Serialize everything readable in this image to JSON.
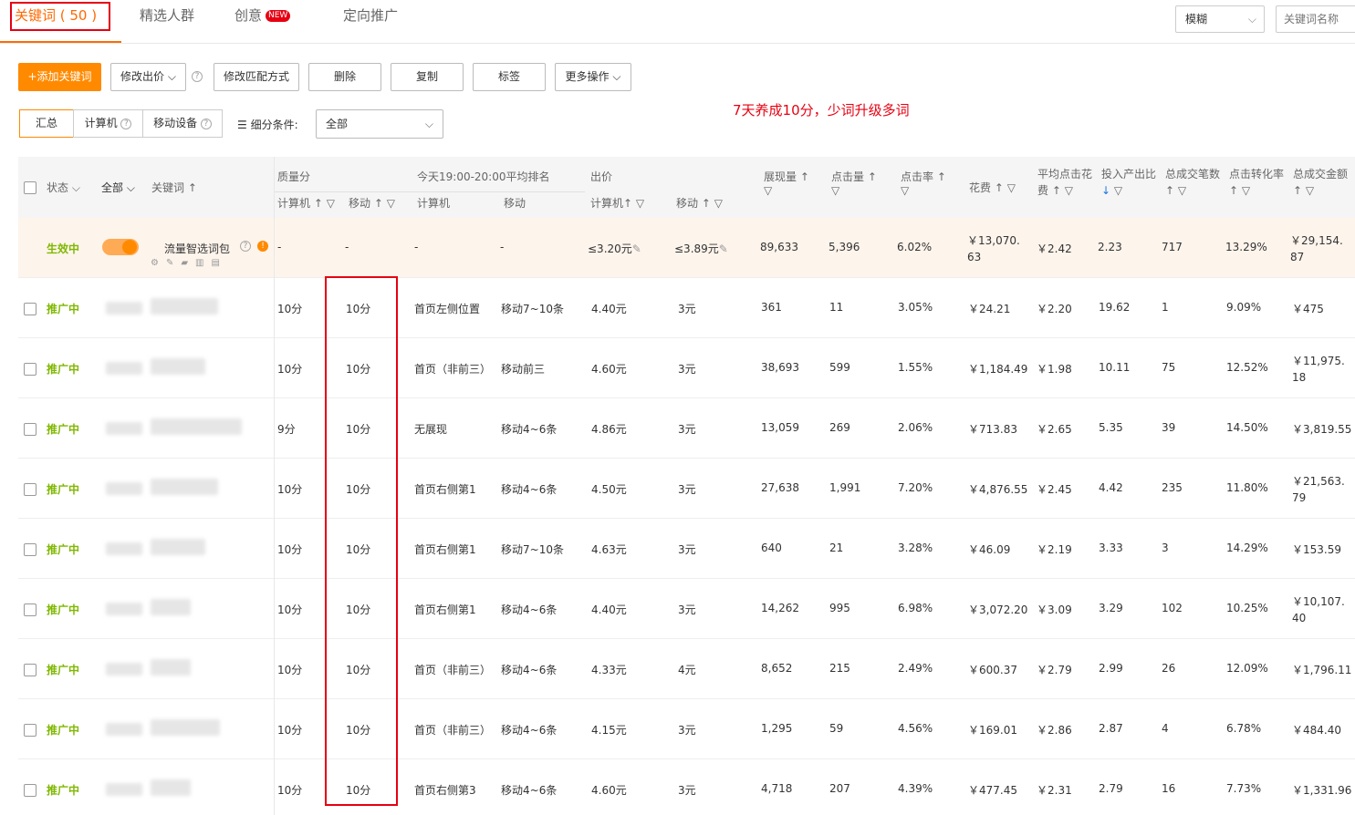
{
  "tabs": [
    {
      "label": "关键词 ( 50 )"
    },
    {
      "label": "精选人群"
    },
    {
      "label": "创意",
      "badge": "NEW"
    },
    {
      "label": "定向推广"
    }
  ],
  "match_mode": "模糊",
  "search_placeholder": "关键词名称",
  "toolbar": {
    "add_keyword": "+添加关键词",
    "edit_bid": "修改出价",
    "edit_match": "修改匹配方式",
    "delete": "删除",
    "copy": "复制",
    "tag": "标签",
    "more": "更多操作"
  },
  "promo": "7天养成10分，少词升级多词",
  "segments": [
    "汇总",
    "计算机",
    "移动设备"
  ],
  "condition_label": "细分条件:",
  "condition_value": "全部",
  "headers": {
    "status": "状态",
    "all": "全部",
    "keyword": "关键词",
    "quality": "质量分",
    "quality_pc": "计算机",
    "quality_mobile": "移动",
    "rank": "今天19:00-20:00平均排名",
    "rank_pc": "计算机",
    "rank_mobile": "移动",
    "bid": "出价",
    "bid_pc": "计算机",
    "bid_mobile": "移动",
    "impressions": "展现量",
    "clicks": "点击量",
    "ctr": "点击率",
    "cost": "花费",
    "cpc_a": "平均点击花",
    "cpc_b": "费",
    "roi": "投入产出比",
    "orders": "总成交笔数",
    "cvr": "点击转化率",
    "gmv": "总成交金额"
  },
  "summary": {
    "status": "生效中",
    "keyword": "流量智选词包",
    "q_pc": "-",
    "q_mobile": "-",
    "r_pc": "-",
    "r_mobile": "-",
    "bid_pc": "≤3.20元",
    "bid_mobile": "≤3.89元",
    "impressions": "89,633",
    "clicks": "5,396",
    "ctr": "6.02%",
    "cost": "￥13,070.63",
    "cpc": "￥2.42",
    "roi": "2.23",
    "orders": "717",
    "cvr": "13.29%",
    "gmv": "￥29,154.87"
  },
  "rows": [
    {
      "status": "推广中",
      "q_pc": "10分",
      "q_mobile": "10分",
      "r_pc": "首页左侧位置",
      "r_mobile": "移动7~10条",
      "bid_pc": "4.40元",
      "bid_mobile": "3元",
      "impressions": "361",
      "clicks": "11",
      "ctr": "3.05%",
      "cost": "￥24.21",
      "cpc": "￥2.20",
      "roi": "19.62",
      "orders": "1",
      "cvr": "9.09%",
      "gmv": "￥475"
    },
    {
      "status": "推广中",
      "q_pc": "10分",
      "q_mobile": "10分",
      "r_pc": "首页（非前三）",
      "r_mobile": "移动前三",
      "bid_pc": "4.60元",
      "bid_mobile": "3元",
      "impressions": "38,693",
      "clicks": "599",
      "ctr": "1.55%",
      "cost": "￥1,184.49",
      "cpc": "￥1.98",
      "roi": "10.11",
      "orders": "75",
      "cvr": "12.52%",
      "gmv": "￥11,975.18"
    },
    {
      "status": "推广中",
      "q_pc": "9分",
      "q_mobile": "10分",
      "r_pc": "无展现",
      "r_mobile": "移动4~6条",
      "bid_pc": "4.86元",
      "bid_mobile": "3元",
      "impressions": "13,059",
      "clicks": "269",
      "ctr": "2.06%",
      "cost": "￥713.83",
      "cpc": "￥2.65",
      "roi": "5.35",
      "orders": "39",
      "cvr": "14.50%",
      "gmv": "￥3,819.55"
    },
    {
      "status": "推广中",
      "q_pc": "10分",
      "q_mobile": "10分",
      "r_pc": "首页右侧第1",
      "r_mobile": "移动4~6条",
      "bid_pc": "4.50元",
      "bid_mobile": "3元",
      "impressions": "27,638",
      "clicks": "1,991",
      "ctr": "7.20%",
      "cost": "￥4,876.55",
      "cpc": "￥2.45",
      "roi": "4.42",
      "orders": "235",
      "cvr": "11.80%",
      "gmv": "￥21,563.79"
    },
    {
      "status": "推广中",
      "q_pc": "10分",
      "q_mobile": "10分",
      "r_pc": "首页右侧第1",
      "r_mobile": "移动7~10条",
      "bid_pc": "4.63元",
      "bid_mobile": "3元",
      "impressions": "640",
      "clicks": "21",
      "ctr": "3.28%",
      "cost": "￥46.09",
      "cpc": "￥2.19",
      "roi": "3.33",
      "orders": "3",
      "cvr": "14.29%",
      "gmv": "￥153.59"
    },
    {
      "status": "推广中",
      "q_pc": "10分",
      "q_mobile": "10分",
      "r_pc": "首页右侧第1",
      "r_mobile": "移动4~6条",
      "bid_pc": "4.40元",
      "bid_mobile": "3元",
      "impressions": "14,262",
      "clicks": "995",
      "ctr": "6.98%",
      "cost": "￥3,072.20",
      "cpc": "￥3.09",
      "roi": "3.29",
      "orders": "102",
      "cvr": "10.25%",
      "gmv": "￥10,107.40"
    },
    {
      "status": "推广中",
      "q_pc": "10分",
      "q_mobile": "10分",
      "r_pc": "首页（非前三）",
      "r_mobile": "移动4~6条",
      "bid_pc": "4.33元",
      "bid_mobile": "4元",
      "impressions": "8,652",
      "clicks": "215",
      "ctr": "2.49%",
      "cost": "￥600.37",
      "cpc": "￥2.79",
      "roi": "2.99",
      "orders": "26",
      "cvr": "12.09%",
      "gmv": "￥1,796.11"
    },
    {
      "status": "推广中",
      "q_pc": "10分",
      "q_mobile": "10分",
      "r_pc": "首页（非前三）",
      "r_mobile": "移动4~6条",
      "bid_pc": "4.15元",
      "bid_mobile": "3元",
      "impressions": "1,295",
      "clicks": "59",
      "ctr": "4.56%",
      "cost": "￥169.01",
      "cpc": "￥2.86",
      "roi": "2.87",
      "orders": "4",
      "cvr": "6.78%",
      "gmv": "￥484.40"
    },
    {
      "status": "推广中",
      "q_pc": "10分",
      "q_mobile": "10分",
      "r_pc": "首页右侧第3",
      "r_mobile": "移动4~6条",
      "bid_pc": "4.60元",
      "bid_mobile": "3元",
      "impressions": "4,718",
      "clicks": "207",
      "ctr": "4.39%",
      "cost": "￥477.45",
      "cpc": "￥2.31",
      "roi": "2.79",
      "orders": "16",
      "cvr": "7.73%",
      "gmv": "￥1,331.96"
    }
  ]
}
